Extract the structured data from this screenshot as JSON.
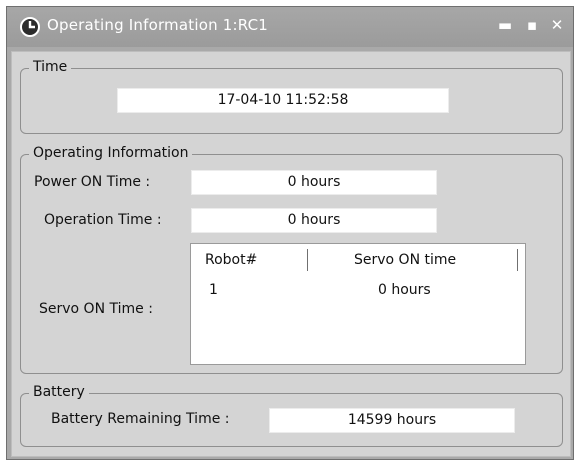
{
  "window": {
    "title": "Operating Information 1:RC1",
    "controls": {
      "minimize": "▬",
      "maximize": "▪",
      "close": "✕"
    }
  },
  "time_group": {
    "legend": "Time",
    "value": "17-04-10 11:52:58"
  },
  "operating_group": {
    "legend": "Operating Information",
    "power_on_label": "Power ON Time :",
    "power_on_value": "0 hours",
    "operation_label": "Operation Time :",
    "operation_value": "0 hours",
    "servo_label": "Servo ON Time :",
    "table": {
      "columns": [
        "Robot#",
        "Servo ON time"
      ],
      "rows": [
        {
          "robot": "1",
          "servo_on_time": "0 hours"
        }
      ]
    }
  },
  "battery_group": {
    "legend": "Battery",
    "remaining_label": "Battery Remaining Time :",
    "remaining_value": "14599 hours"
  },
  "colors": {
    "title_bar": "#a2a2a2",
    "client_bg": "#d4d4d4",
    "field_bg": "#ffffff"
  }
}
